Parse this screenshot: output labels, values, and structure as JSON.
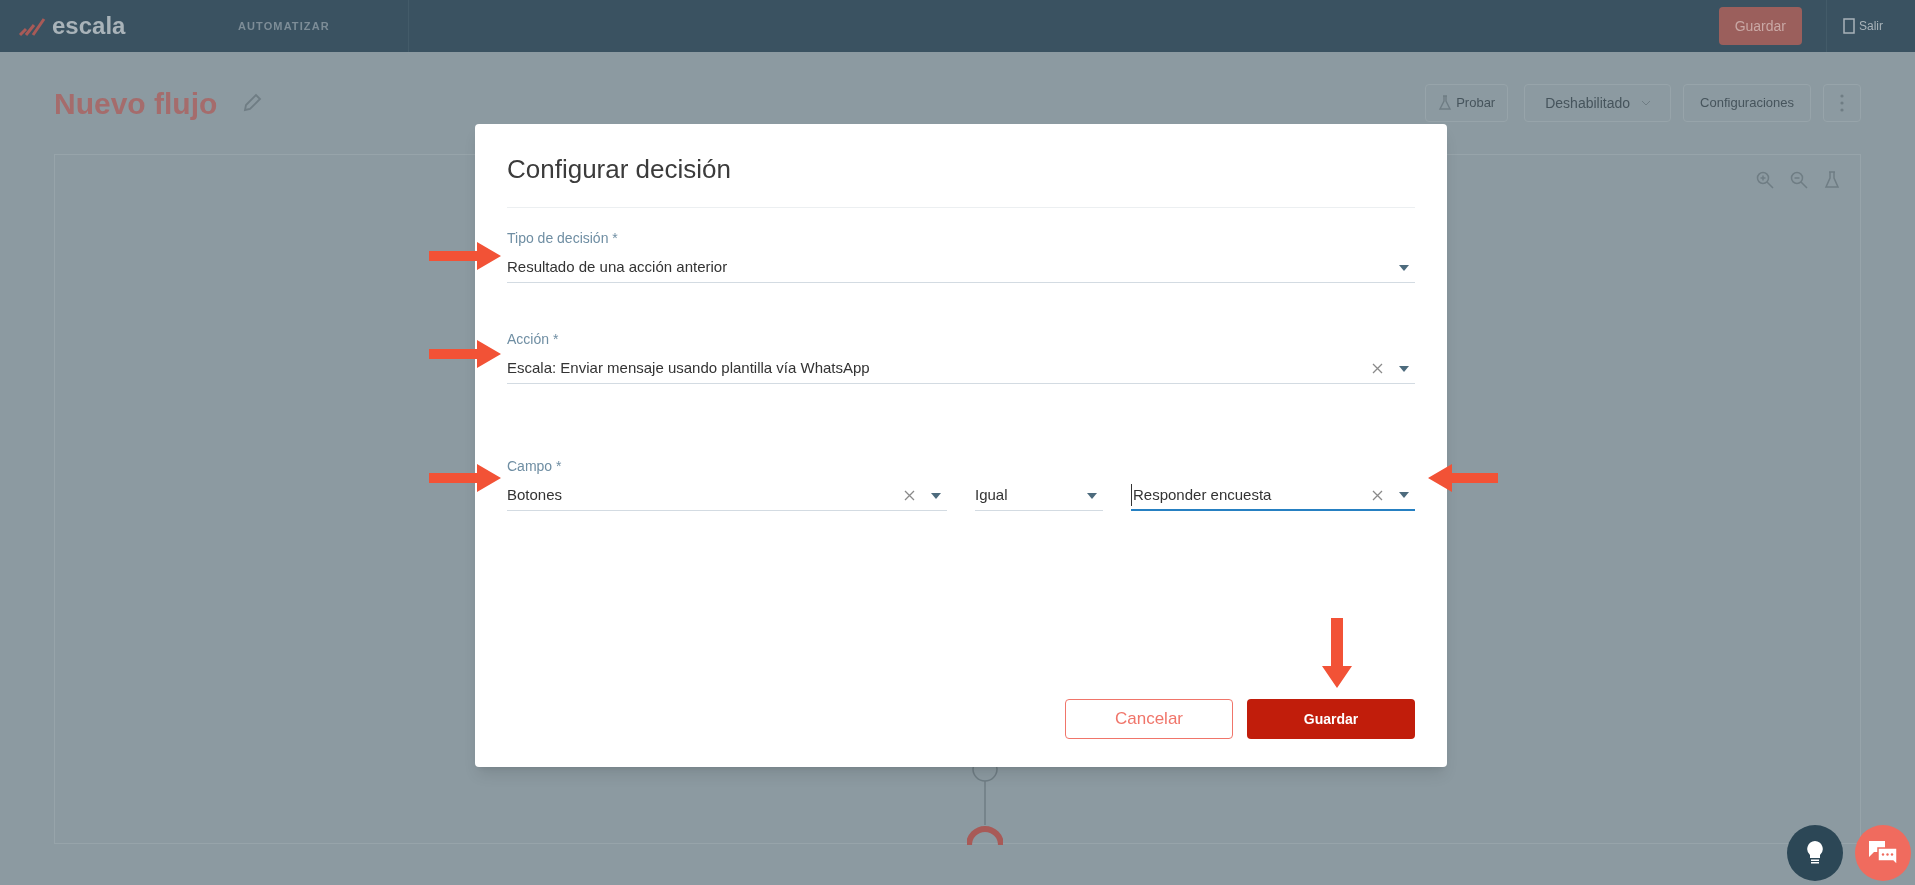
{
  "top_bar": {
    "logo": "escala",
    "nav_item": "AUTOMATIZAR",
    "save_button": "Guardar",
    "logout": "Salir"
  },
  "page": {
    "title": "Nuevo flujo",
    "test_button": "Probar",
    "status_dropdown": "Deshabilitado",
    "settings_button": "Configuraciones"
  },
  "dialog": {
    "title": "Configurar decisión",
    "fields": [
      {
        "label": "Tipo de decisión *",
        "value": "Resultado de una acción anterior",
        "clearable": false,
        "focused": false
      },
      {
        "label": "Acción *",
        "value": "Escala: Enviar mensaje usando plantilla vía WhatsApp",
        "clearable": true,
        "focused": false
      }
    ],
    "condition": {
      "label": "Campo *",
      "selects": [
        {
          "value": "Botones",
          "clearable": true,
          "focused": false
        },
        {
          "value": "Igual",
          "clearable": false,
          "focused": false
        },
        {
          "value": "Responder encuesta",
          "clearable": true,
          "focused": true
        }
      ]
    },
    "buttons": [
      {
        "label": "Cancelar",
        "kind": "secondary"
      },
      {
        "label": "Guardar",
        "kind": "primary"
      }
    ]
  }
}
